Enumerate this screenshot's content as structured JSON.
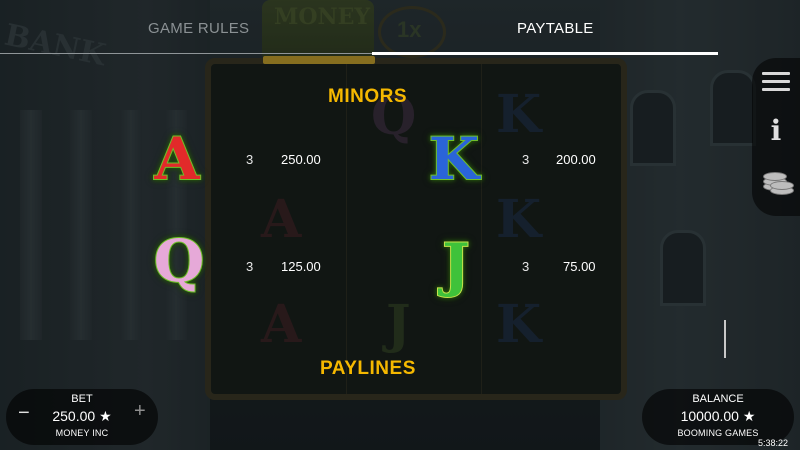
{
  "tabs": {
    "game_rules": "GAME RULES",
    "paytable": "PAYTABLE",
    "active": "PAYTABLE"
  },
  "background": {
    "bank_sign": "BANK",
    "logo_text": "MONEY",
    "multiplier": "1x"
  },
  "paytable": {
    "minors_title": "MINORS",
    "paylines_title": "PAYLINES",
    "symbols": [
      {
        "symbol": "A",
        "icon": "letter-a-icon",
        "color": "#e22a2a",
        "count": "3",
        "value": "250.00"
      },
      {
        "symbol": "K",
        "icon": "letter-k-icon",
        "color": "#2a64d8",
        "count": "3",
        "value": "200.00"
      },
      {
        "symbol": "Q",
        "icon": "letter-q-icon",
        "color": "#e6a9d8",
        "count": "3",
        "value": "125.00"
      },
      {
        "symbol": "J",
        "icon": "letter-j-icon",
        "color": "#3fc23a",
        "count": "3",
        "value": "75.00"
      }
    ]
  },
  "side_menu": {
    "items": [
      {
        "icon": "hamburger-menu-icon"
      },
      {
        "icon": "info-icon",
        "glyph": "i"
      },
      {
        "icon": "coin-stack-icon"
      }
    ]
  },
  "bet": {
    "label": "BET",
    "value": "250.00 ★",
    "game_name": "MONEY INC",
    "minus": "−",
    "plus": "+"
  },
  "balance": {
    "label": "BALANCE",
    "value": "10000.00 ★",
    "brand": "BOOMING GAMES"
  },
  "clock": "5:38:22",
  "colors": {
    "accent_gold": "#f5b800",
    "tab_inactive": "#8b9194",
    "tab_active": "#ffffff"
  }
}
